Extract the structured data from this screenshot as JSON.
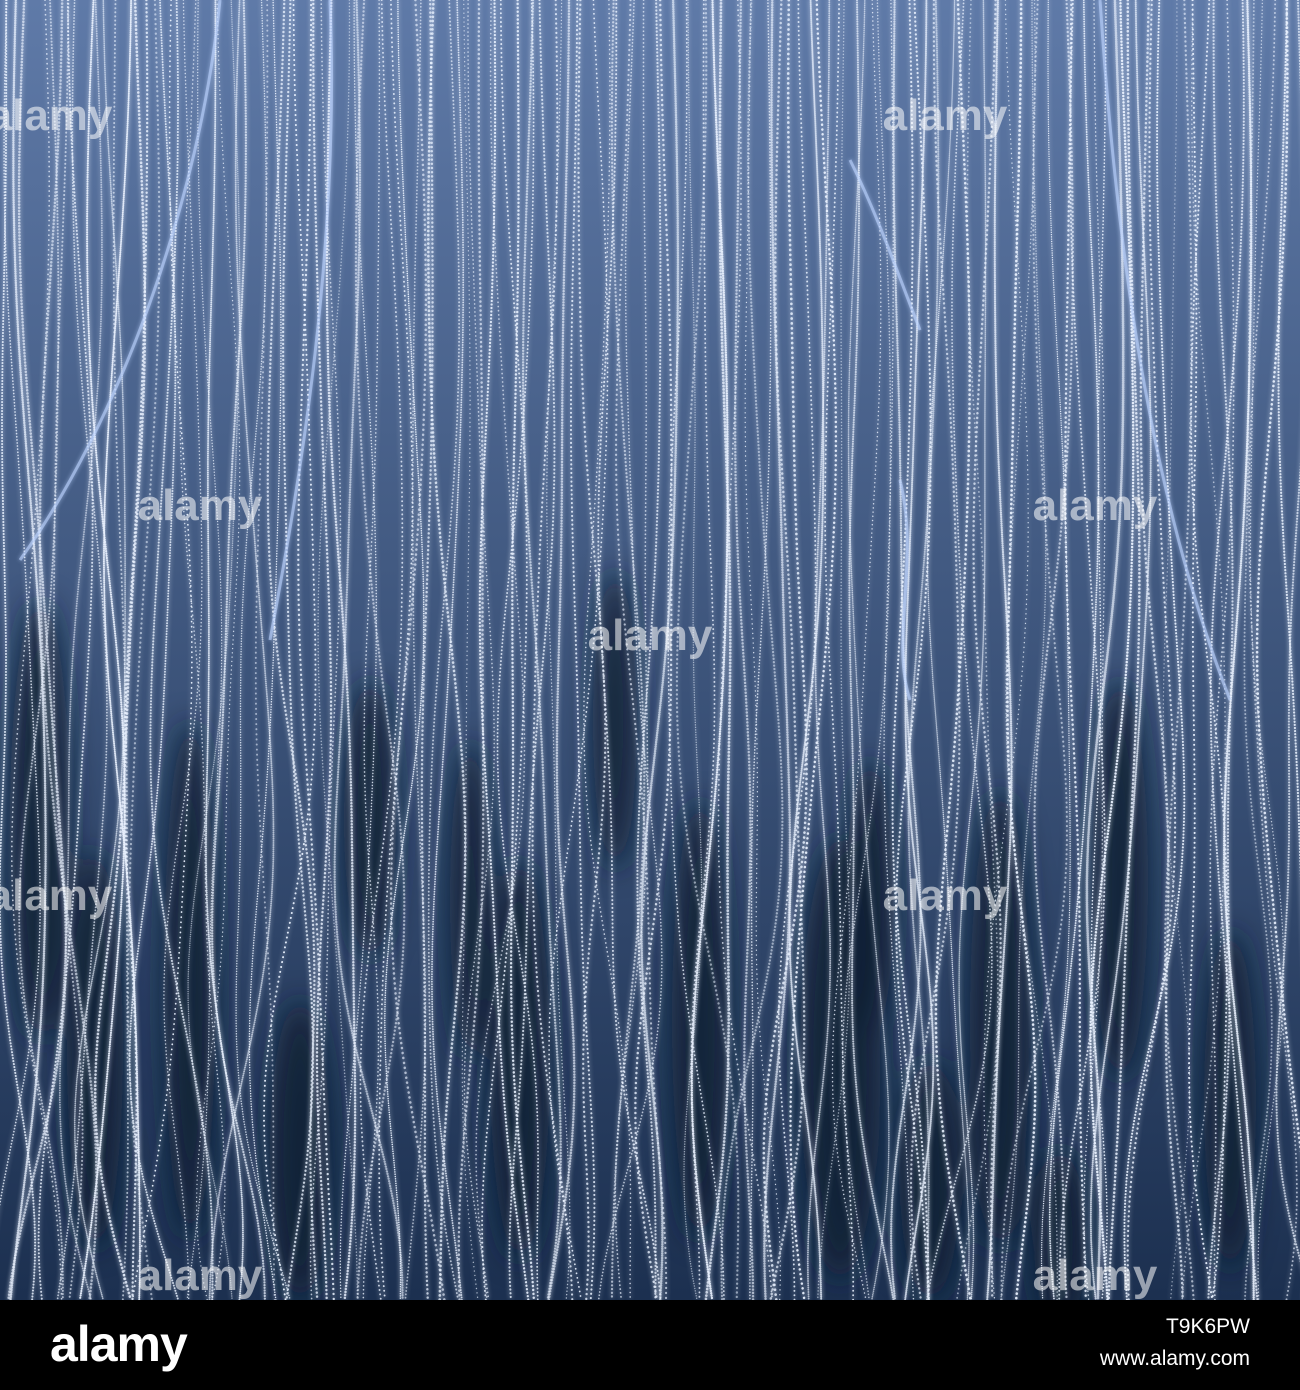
{
  "artwork": {
    "subject": "glowing-particle-curtain-waves",
    "colors": {
      "background_top": "#5f7aa8",
      "background_bottom": "#1c3050",
      "particle": "#eaf2ff",
      "glow": "#bcd4ff",
      "shadow": "#0f1d33"
    }
  },
  "watermark": {
    "text": "alamy"
  },
  "footer": {
    "brand": "alamy",
    "image_id": "T9K6PW",
    "url": "www.alamy.com",
    "colors": {
      "bar": "#000000",
      "text": "#ffffff"
    }
  }
}
